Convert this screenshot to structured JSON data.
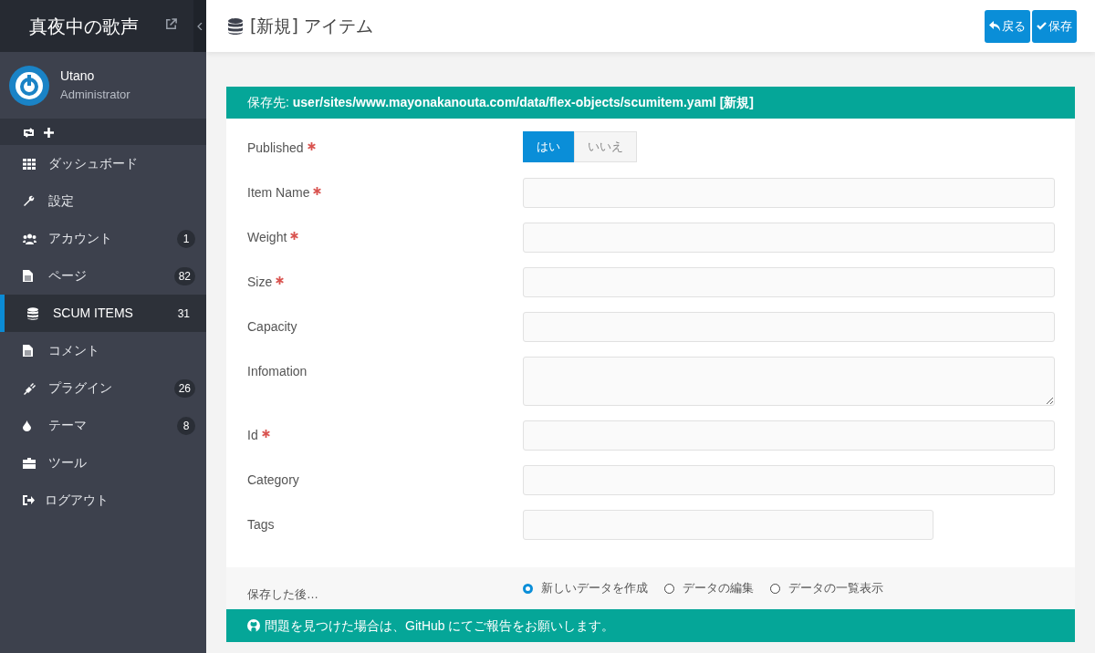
{
  "sidebar": {
    "site_title": "真夜中の歌声",
    "user": {
      "name": "Utano",
      "role": "Administrator"
    },
    "items": [
      {
        "kind": "dashboard",
        "label": "ダッシュボード",
        "selected": false
      },
      {
        "kind": "settings",
        "label": "設定",
        "selected": false
      },
      {
        "kind": "accounts",
        "label": "アカウント",
        "count": "1",
        "selected": false
      },
      {
        "kind": "pages",
        "label": "ページ",
        "count": "82",
        "selected": false
      },
      {
        "kind": "database",
        "label": "SCUM ITEMS",
        "count": "31",
        "selected": true
      },
      {
        "kind": "pages",
        "label": "コメント",
        "selected": false
      },
      {
        "kind": "plugins",
        "label": "プラグイン",
        "count": "26",
        "selected": false
      },
      {
        "kind": "themes",
        "label": "テーマ",
        "count": "8",
        "selected": false
      },
      {
        "kind": "tools",
        "label": "ツール",
        "selected": false
      },
      {
        "kind": "logout",
        "label": "ログアウト",
        "selected": false
      }
    ]
  },
  "header": {
    "title": "[新規] アイテム",
    "buttons": [
      {
        "kind": "back",
        "label": "戻る"
      },
      {
        "kind": "save",
        "label": "保存"
      }
    ]
  },
  "save_path": "保存先: **user/sites/www.mayonakanouta.com/data/flex-objects/scumitem.yaml [新規]**",
  "fields": [
    {
      "kind": "toggle",
      "label": "Published",
      "required": true,
      "options": [
        {
          "label": "はい",
          "selected": true
        },
        {
          "label": "いいえ",
          "selected": false
        }
      ]
    },
    {
      "kind": "text",
      "label": "Item Name",
      "required": true
    },
    {
      "kind": "text",
      "label": "Weight",
      "required": true
    },
    {
      "kind": "text",
      "label": "Size",
      "required": true
    },
    {
      "kind": "text",
      "label": "Capacity",
      "required": false
    },
    {
      "kind": "textarea",
      "label": "Infomation",
      "required": false
    },
    {
      "kind": "text",
      "label": "Id",
      "required": true
    },
    {
      "kind": "text",
      "label": "Category",
      "required": false
    },
    {
      "kind": "tags",
      "label": "Tags",
      "required": false
    }
  ],
  "after_save": {
    "label": "保存した後…",
    "options": [
      {
        "label": "新しいデータを作成",
        "selected": true
      },
      {
        "label": "データの編集",
        "selected": false
      },
      {
        "label": "データの一覧表示",
        "selected": false
      }
    ]
  },
  "footer": "問題を見つけた場合は、GitHub にてご報告をお願いします。"
}
